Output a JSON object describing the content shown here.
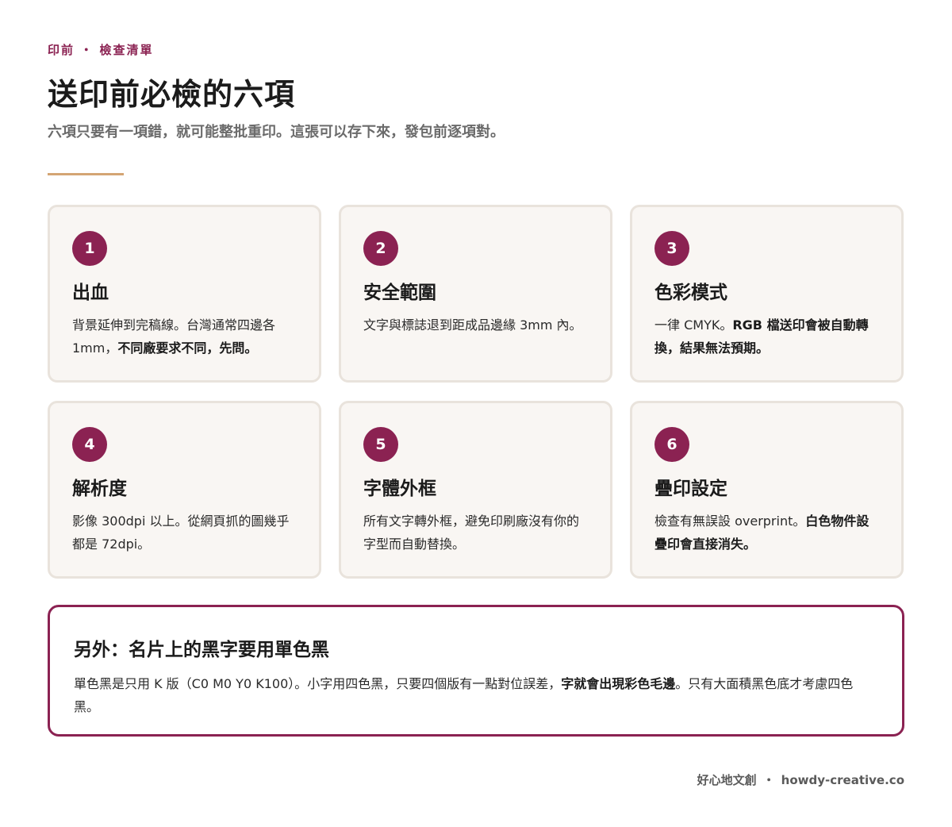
{
  "header": {
    "eyebrow": "印前 ・ 檢查清單",
    "title": "送印前必檢的六項",
    "subtitle": "六項只要有一項錯，就可能整批重印。這張可以存下來，發包前逐項對。"
  },
  "colors": {
    "accent": "#8b2252",
    "rule": "#d4a574",
    "card_bg": "#f9f6f3",
    "card_border": "#e9e3dc"
  },
  "cards": [
    {
      "number": "1",
      "title": "出血",
      "body_plain": "背景延伸到完稿線。台灣通常四邊各 1mm，",
      "body_bold": "不同廠要求不同，先問。"
    },
    {
      "number": "2",
      "title": "安全範圍",
      "body_plain": "文字與標誌退到距成品邊緣 3mm 內。",
      "body_bold": ""
    },
    {
      "number": "3",
      "title": "色彩模式",
      "body_plain": "一律 CMYK。",
      "body_bold": "RGB 檔送印會被自動轉換，結果無法預期。"
    },
    {
      "number": "4",
      "title": "解析度",
      "body_plain": "影像 300dpi 以上。從網頁抓的圖幾乎都是 72dpi。",
      "body_bold": ""
    },
    {
      "number": "5",
      "title": "字體外框",
      "body_plain": "所有文字轉外框，避免印刷廠沒有你的字型而自動替換。",
      "body_bold": ""
    },
    {
      "number": "6",
      "title": "疊印設定",
      "body_plain": "檢查有無誤設 overprint。",
      "body_bold": "白色物件設疊印會直接消失。"
    }
  ],
  "note": {
    "title": "另外：名片上的黑字要用單色黑",
    "body_plain_1": "單色黑是只用 K 版（C0 M0 Y0 K100）。小字用四色黑，只要四個版有一點對位誤差，",
    "body_bold": "字就會出現彩色毛邊",
    "body_plain_2": "。只有大面積黑色底才考慮四色黑。"
  },
  "footer": {
    "brand": "好心地文創",
    "separator": "・",
    "site": "howdy-creative.co"
  }
}
